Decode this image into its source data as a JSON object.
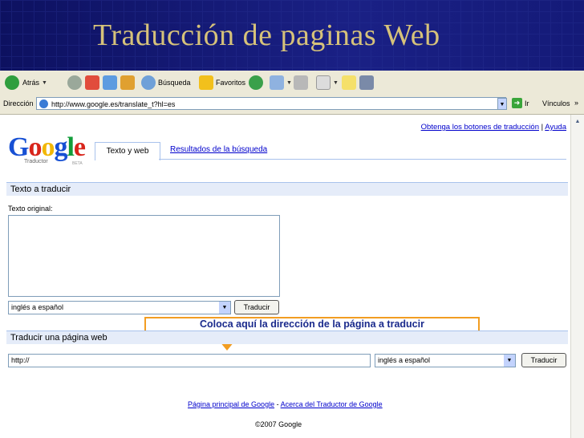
{
  "slide": {
    "title": "Traducción de paginas Web"
  },
  "toolbar": {
    "back_label": "Atrás",
    "search_label": "Búsqueda",
    "favorites_label": "Favoritos"
  },
  "address": {
    "label": "Dirección",
    "url": "http://www.google.es/translate_t?hl=es",
    "go_label": "Ir",
    "links_label": "Vínculos"
  },
  "page": {
    "top_links": {
      "buttons": "Obtenga los botones de traducción",
      "separator": " | ",
      "help": "Ayuda"
    },
    "logo": {
      "word": "Google",
      "sub": "Traductor",
      "beta": "BETA"
    },
    "tabs": {
      "active": "Texto y web",
      "results": "Resultados de la búsqueda"
    },
    "text_section": {
      "header": "Texto a traducir",
      "source_label": "Texto original:",
      "language": "inglés a español",
      "button": "Traducir"
    },
    "web_section": {
      "header": "Traducir una página web",
      "url_value": "http://",
      "language": "inglés a español",
      "button": "Traducir"
    },
    "callout": "Coloca aquí la dirección de la página a traducir",
    "footer": {
      "home": "Página principal de Google",
      "separator": " - ",
      "about": "Acerca del Traductor de Google",
      "copyright": "©2007 Google"
    }
  },
  "colors": {
    "header_bg": "#13186f",
    "title": "#d6c27a",
    "callout_border": "#f29d22",
    "link": "#0000cc"
  }
}
